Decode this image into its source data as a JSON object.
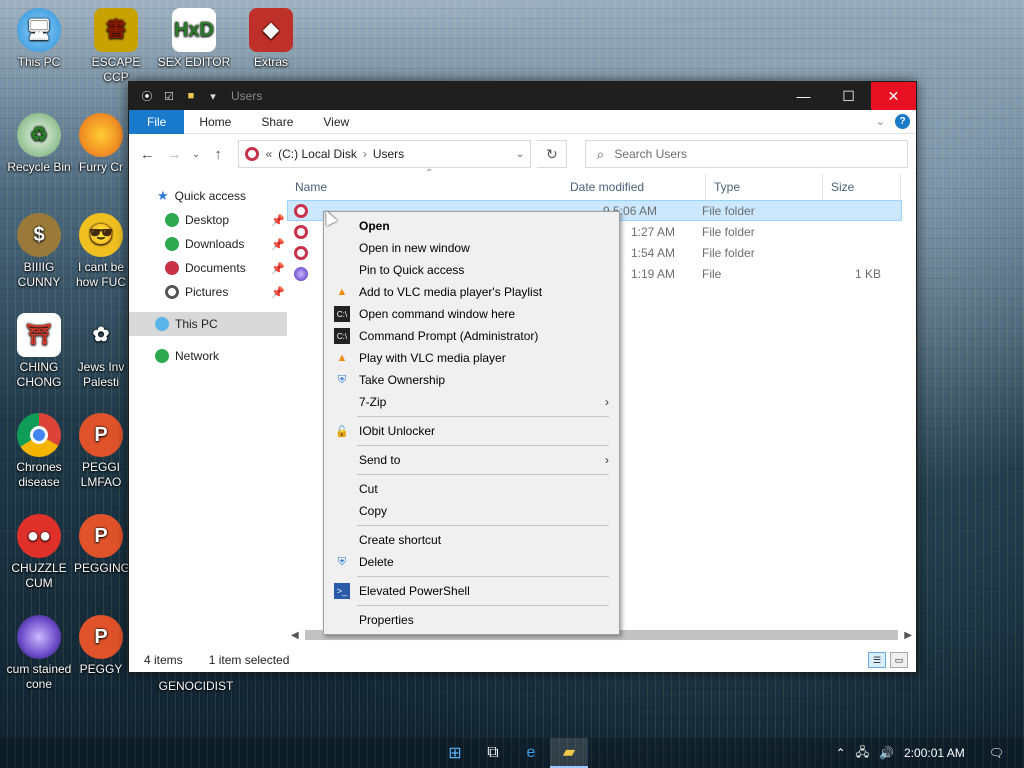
{
  "desktop": {
    "icons": [
      {
        "label": "This PC",
        "icon": "monitor-icon",
        "color": "#2a8fd6"
      },
      {
        "label": "ESCAPE CCP",
        "icon": "book-icon",
        "color": "#c8a200"
      },
      {
        "label": "SEX EDITOR",
        "icon": "hxd-icon",
        "color": "#ffffff"
      },
      {
        "label": "Extras",
        "icon": "box-icon",
        "color": "#c0302a"
      },
      {
        "label": "Recycle Bin",
        "icon": "recycle-icon",
        "color": "#6aa86a"
      },
      {
        "label": "Furry Cr",
        "icon": "firefox-icon",
        "color": "#e86a1a"
      },
      {
        "label": "BIIIIG CUNNY",
        "icon": "moneybag-icon",
        "color": "#9a7a3a"
      },
      {
        "label": "I cant be how FUC",
        "icon": "emoji-icon",
        "color": "#f0c020"
      },
      {
        "label": "CHING CHONG",
        "icon": "torii-icon",
        "color": "#d23a2a"
      },
      {
        "label": "Jews Inv Palesti",
        "icon": "flower-icon",
        "color": "#f3f3f3"
      },
      {
        "label": "Chrones disease",
        "icon": "chrome-icon",
        "color": "#3d8ce0"
      },
      {
        "label": "PEGGI LMFAO",
        "icon": "p-icon",
        "color": "#e0532a"
      },
      {
        "label": "CHUZZLE CUM",
        "icon": "chuzzle-icon",
        "color": "#e0302a"
      },
      {
        "label": "PEGGING",
        "icon": "p-icon",
        "color": "#e0532a"
      },
      {
        "label": "cum stained cone",
        "icon": "orb-icon",
        "color": "#6a4ac8"
      },
      {
        "label": "PEGGY",
        "icon": "p-icon",
        "color": "#e0532a"
      },
      {
        "label": "GENOCIDIST",
        "icon": "none",
        "color": "#000000"
      }
    ]
  },
  "explorer": {
    "title": "Users",
    "ribbon_tabs": [
      "File",
      "Home",
      "Share",
      "View"
    ],
    "address": {
      "prefix": "«",
      "drive": "(C:) Local Disk",
      "sep": "›",
      "folder": "Users"
    },
    "search_placeholder": "Search Users",
    "nav": {
      "quick_access": "Quick access",
      "items": [
        "Desktop",
        "Downloads",
        "Documents",
        "Pictures"
      ],
      "this_pc": "This PC",
      "network": "Network"
    },
    "columns": [
      "Name",
      "Date modified",
      "Type",
      "Size"
    ],
    "rows": [
      {
        "date": "9 5:06 AM",
        "type": "File folder",
        "size": ""
      },
      {
        "date": "1:27 AM",
        "type": "File folder",
        "size": ""
      },
      {
        "date": "1:54 AM",
        "type": "File folder",
        "size": ""
      },
      {
        "date": "1:19 AM",
        "type": "File",
        "size": "1 KB"
      }
    ],
    "status": {
      "items": "4 items",
      "selected": "1 item selected"
    }
  },
  "context_menu": {
    "groups": [
      [
        "Open",
        "Open in new window",
        "Pin to Quick access",
        "Add to VLC media player's Playlist",
        "Open command window here",
        "Command Prompt (Administrator)",
        "Play with VLC media player",
        "Take Ownership",
        "7-Zip"
      ],
      [
        "IObit Unlocker"
      ],
      [
        "Send to"
      ],
      [
        "Cut",
        "Copy"
      ],
      [
        "Create shortcut",
        "Delete"
      ],
      [
        "Elevated PowerShell"
      ],
      [
        "Properties"
      ]
    ]
  },
  "taskbar": {
    "clock": "2:00:01 AM"
  },
  "colors": {
    "accent": "#1979ca",
    "close": "#e81123",
    "selection": "#cce8ff"
  }
}
